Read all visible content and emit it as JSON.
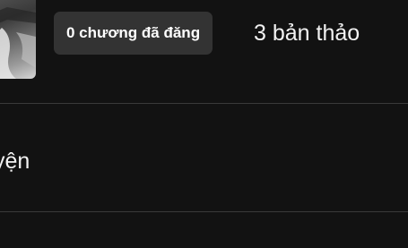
{
  "story": {
    "cover": {
      "icon": "book-cover-image"
    },
    "published_label": "0 chương đã đăng",
    "drafts_label": "3 bản thảo"
  },
  "row": {
    "label": "yện"
  },
  "colors": {
    "background": "#121212",
    "badge_background": "#333333",
    "divider": "#3a3a3a",
    "text": "#ffffff"
  }
}
